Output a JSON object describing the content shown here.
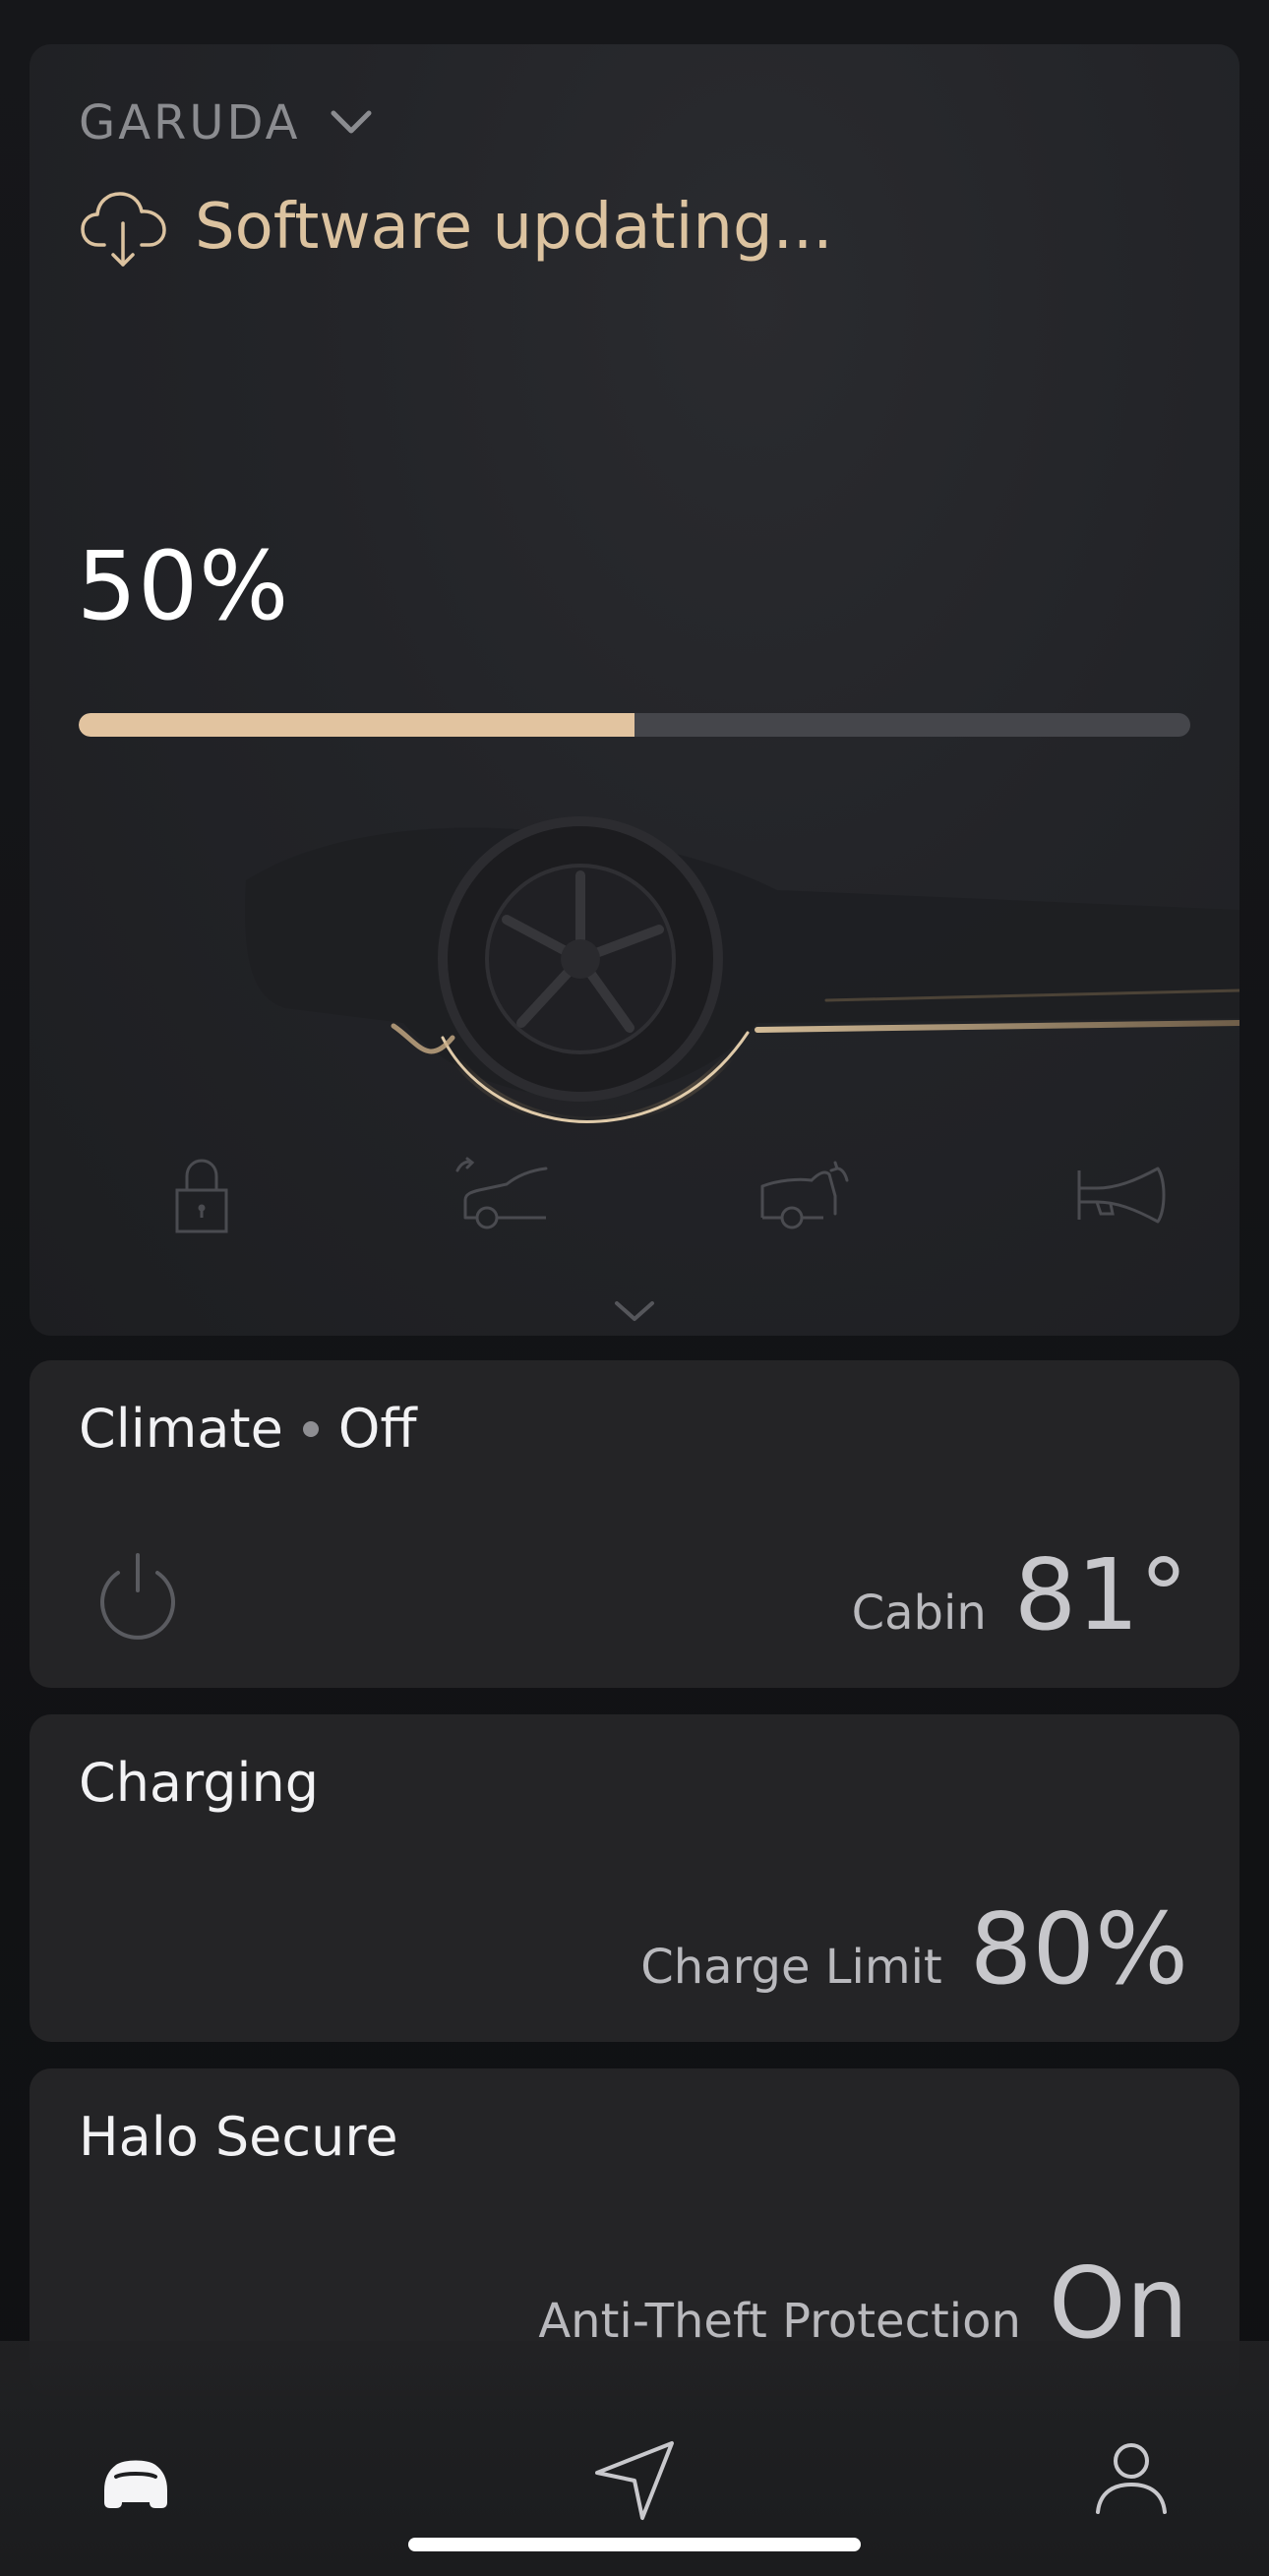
{
  "vehicle": {
    "name": "GARUDA"
  },
  "update": {
    "status": "Software updating...",
    "percent_label": "50%",
    "progress": 0.5
  },
  "quick_actions": [
    {
      "icon": "lock-icon"
    },
    {
      "icon": "frunk-icon"
    },
    {
      "icon": "trunk-icon"
    },
    {
      "icon": "horn-icon"
    }
  ],
  "climate": {
    "title": "Climate",
    "state": "Off",
    "label": "Cabin",
    "value": "81°"
  },
  "charging": {
    "title": "Charging",
    "label": "Charge Limit",
    "value": "80%"
  },
  "security": {
    "title": "Halo Secure",
    "label": "Anti-Theft Protection",
    "value": "On"
  },
  "tabs": [
    {
      "icon": "car-icon",
      "active": true
    },
    {
      "icon": "navigation-icon",
      "active": false
    },
    {
      "icon": "profile-icon",
      "active": false
    }
  ],
  "colors": {
    "accent": "#e2c4a0",
    "track": "#45464b",
    "card": "#242426"
  }
}
